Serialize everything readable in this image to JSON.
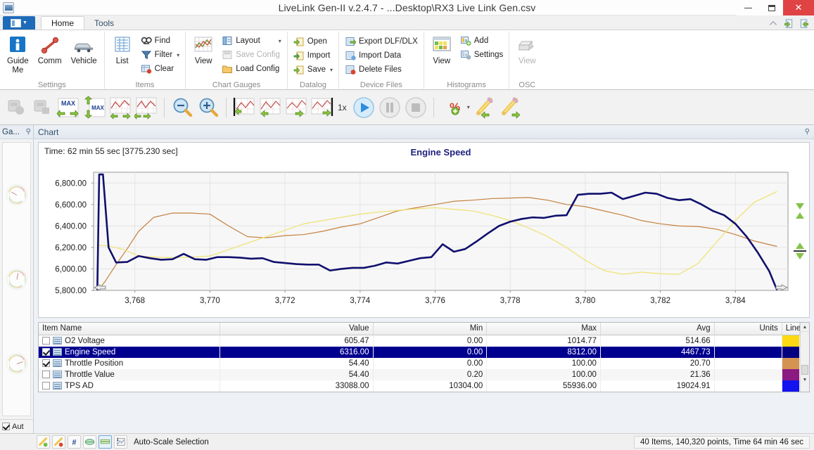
{
  "window": {
    "title": "LiveLink Gen-II  v.2.4.7 - ...Desktop\\RX3 Live Link Gen.csv",
    "minimize": "—",
    "maximize": "□",
    "close": "✕"
  },
  "ribbon": {
    "app_button": "app-menu",
    "tabs": [
      {
        "label": "Home",
        "active": true
      },
      {
        "label": "Tools",
        "active": false
      }
    ],
    "quick_icons": [
      "help-icon",
      "import-icon",
      "export-icon"
    ],
    "groups": [
      {
        "name": "Settings",
        "label": "Settings",
        "big_buttons": [
          {
            "label": "Guide\nMe",
            "line1": "Guide",
            "line2": "Me",
            "icon": "guide-me-icon"
          },
          {
            "label": "Comm",
            "icon": "comm-icon"
          },
          {
            "label": "Vehicle",
            "icon": "vehicle-icon"
          }
        ],
        "small_buttons": []
      },
      {
        "name": "Items",
        "label": "Items",
        "big_buttons": [
          {
            "label": "List",
            "icon": "list-icon"
          }
        ],
        "small_buttons": [
          {
            "label": "Find",
            "icon": "find-icon",
            "disabled": false,
            "caret": false
          },
          {
            "label": "Filter",
            "icon": "filter-icon",
            "disabled": false,
            "caret": true
          },
          {
            "label": "Clear",
            "icon": "clear-icon",
            "disabled": false,
            "caret": false
          }
        ]
      },
      {
        "name": "Chart Gauges",
        "label": "Chart Gauges",
        "big_buttons": [
          {
            "label": "View",
            "icon": "chart-view-icon"
          }
        ],
        "small_buttons": [
          {
            "label": "Layout",
            "icon": "layout-icon",
            "disabled": false,
            "caret": true
          },
          {
            "label": "Save Config",
            "icon": "save-config-icon",
            "disabled": true,
            "caret": false
          },
          {
            "label": "Load Config",
            "icon": "load-config-icon",
            "disabled": false,
            "caret": false
          }
        ]
      },
      {
        "name": "Datalog",
        "label": "Datalog",
        "big_buttons": [],
        "small_buttons": [
          {
            "label": "Open",
            "icon": "open-icon",
            "disabled": false,
            "caret": false
          },
          {
            "label": "Import",
            "icon": "import-icon",
            "disabled": false,
            "caret": false
          },
          {
            "label": "Save",
            "icon": "save-icon",
            "disabled": false,
            "caret": true
          }
        ]
      },
      {
        "name": "Device Files",
        "label": "Device Files",
        "big_buttons": [],
        "small_buttons": [
          {
            "label": "Export DLF/DLX",
            "icon": "export-dlf-icon",
            "disabled": false,
            "caret": false
          },
          {
            "label": "Import Data",
            "icon": "import-data-icon",
            "disabled": false,
            "caret": false
          },
          {
            "label": "Delete Files",
            "icon": "delete-files-icon",
            "disabled": false,
            "caret": false
          }
        ]
      },
      {
        "name": "Histograms",
        "label": "Histograms",
        "big_buttons": [
          {
            "label": "View",
            "icon": "histogram-view-icon"
          }
        ],
        "small_buttons": [
          {
            "label": "Add",
            "icon": "add-icon",
            "disabled": false,
            "caret": false
          },
          {
            "label": "Settings",
            "icon": "settings-icon",
            "disabled": false,
            "caret": false
          }
        ]
      },
      {
        "name": "OSC",
        "label": "OSC",
        "big_buttons": [
          {
            "label": "View",
            "icon": "osc-view-icon",
            "disabled": true
          }
        ],
        "small_buttons": []
      }
    ]
  },
  "toolbar": {
    "speed_label": "1x",
    "buttons": [
      {
        "name": "record-disabled-icon",
        "disabled": true
      },
      {
        "name": "stop-record-disabled-icon",
        "disabled": true
      },
      {
        "name": "max-left-right-icon",
        "disabled": false
      },
      {
        "name": "max-up-down-icon",
        "disabled": false
      },
      {
        "name": "chart-pan-left-right-icon",
        "disabled": false
      },
      {
        "name": "chart-pan-right-left-icon",
        "disabled": false
      },
      {
        "name": "zoom-out-icon",
        "disabled": false
      },
      {
        "name": "zoom-in-icon",
        "disabled": false
      },
      {
        "name": "chart-marker-start-icon",
        "disabled": false
      },
      {
        "name": "chart-marker-left-icon",
        "disabled": false
      },
      {
        "name": "chart-marker-right-icon",
        "disabled": false
      },
      {
        "name": "chart-marker-end-icon",
        "disabled": false
      },
      {
        "name": "play-button",
        "disabled": false
      },
      {
        "name": "pause-button",
        "disabled": true
      },
      {
        "name": "stop-button",
        "disabled": true
      },
      {
        "name": "percent-icon",
        "disabled": false
      },
      {
        "name": "edit-back-icon",
        "disabled": false
      },
      {
        "name": "edit-forward-icon",
        "disabled": false
      }
    ]
  },
  "gauge_panel": {
    "title": "Ga...",
    "pin": "pin-icon",
    "auto_label": "Aut",
    "auto_checked": true,
    "gauges": [
      "gauge-1",
      "gauge-2",
      "gauge-3"
    ]
  },
  "chart_panel": {
    "header_title": "Chart",
    "pin": "pin-icon",
    "time_label": "Time: 62 min 55 sec [3775.230 sec]"
  },
  "chart_data": {
    "type": "line",
    "title": "Engine Speed",
    "xlabel": "",
    "ylabel": "",
    "xlim": [
      3766.9,
      3785.4
    ],
    "ylim": [
      5800,
      6900
    ],
    "yticks": [
      5800,
      6000,
      6200,
      6400,
      6600,
      6800
    ],
    "ytick_labels": [
      "5,800.00",
      "6,000.00",
      "6,200.00",
      "6,400.00",
      "6,600.00",
      "6,800.00"
    ],
    "xticks": [
      3768,
      3770,
      3772,
      3774,
      3776,
      3778,
      3780,
      3782,
      3784
    ],
    "xtick_labels": [
      "3,768",
      "3,770",
      "3,772",
      "3,774",
      "3,776",
      "3,778",
      "3,780",
      "3,782",
      "3,784"
    ],
    "grid": true,
    "legend_position": "none",
    "series": [
      {
        "name": "Engine Speed",
        "color": "#10106e",
        "width": 2.6,
        "x": [
          3767.0,
          3767.05,
          3767.15,
          3767.3,
          3767.5,
          3767.8,
          3768.1,
          3768.4,
          3768.7,
          3769.0,
          3769.3,
          3769.6,
          3769.9,
          3770.2,
          3770.5,
          3770.8,
          3771.1,
          3771.4,
          3771.7,
          3772.0,
          3772.3,
          3772.6,
          3772.9,
          3773.2,
          3773.5,
          3773.8,
          3774.1,
          3774.4,
          3774.7,
          3775.0,
          3775.3,
          3775.6,
          3775.9,
          3776.2,
          3776.5,
          3776.8,
          3777.1,
          3777.4,
          3777.7,
          3778.0,
          3778.3,
          3778.6,
          3778.9,
          3779.2,
          3779.5,
          3779.8,
          3780.1,
          3780.4,
          3780.7,
          3781.0,
          3781.3,
          3781.6,
          3781.9,
          3782.2,
          3782.5,
          3782.8,
          3783.1,
          3783.4,
          3783.7,
          3784.0,
          3784.3,
          3784.6,
          3784.9,
          3785.1
        ],
        "y": [
          5810,
          6880,
          6880,
          6200,
          6060,
          6065,
          6120,
          6100,
          6085,
          6090,
          6140,
          6090,
          6085,
          6110,
          6110,
          6105,
          6095,
          6100,
          6065,
          6055,
          6045,
          6040,
          6040,
          5985,
          6000,
          6010,
          6010,
          6030,
          6060,
          6050,
          6075,
          6100,
          6110,
          6230,
          6160,
          6185,
          6255,
          6330,
          6400,
          6440,
          6465,
          6480,
          6475,
          6495,
          6500,
          6690,
          6700,
          6700,
          6710,
          6650,
          6680,
          6710,
          6700,
          6660,
          6640,
          6650,
          6600,
          6540,
          6500,
          6420,
          6300,
          6150,
          5980,
          5810
        ]
      },
      {
        "name": "Throttle Position",
        "color": "#c4813f",
        "width": 1.2,
        "x": [
          3767.0,
          3767.2,
          3767.5,
          3767.8,
          3768.1,
          3768.5,
          3769.0,
          3769.5,
          3770.0,
          3770.5,
          3771.0,
          3771.5,
          3772.0,
          3772.5,
          3773.0,
          3773.5,
          3774.0,
          3774.5,
          3775.0,
          3775.5,
          3776.0,
          3776.5,
          3777.0,
          3777.5,
          3778.0,
          3778.5,
          3779.0,
          3779.5,
          3780.0,
          3780.5,
          3781.0,
          3781.5,
          3782.0,
          3782.5,
          3783.0,
          3783.5,
          3784.0,
          3784.5,
          3785.1
        ],
        "y": [
          5790,
          5880,
          6040,
          6190,
          6350,
          6480,
          6520,
          6520,
          6510,
          6400,
          6300,
          6290,
          6310,
          6320,
          6350,
          6390,
          6420,
          6480,
          6540,
          6570,
          6600,
          6630,
          6640,
          6655,
          6660,
          6665,
          6640,
          6600,
          6580,
          6540,
          6500,
          6450,
          6420,
          6400,
          6395,
          6370,
          6320,
          6260,
          6210
        ]
      },
      {
        "name": "O2 Voltage",
        "color": "#f0e27a",
        "width": 1.3,
        "x": [
          3767.0,
          3767.3,
          3767.7,
          3768.1,
          3768.5,
          3769.0,
          3769.5,
          3770.0,
          3770.5,
          3771.0,
          3771.5,
          3772.0,
          3772.5,
          3773.0,
          3773.5,
          3774.0,
          3774.5,
          3775.0,
          3775.5,
          3776.0,
          3776.5,
          3777.0,
          3777.5,
          3778.0,
          3778.5,
          3779.0,
          3779.5,
          3780.0,
          3780.5,
          3781.0,
          3781.5,
          3782.0,
          3782.5,
          3783.0,
          3783.5,
          3784.0,
          3784.5,
          3785.1
        ],
        "y": [
          6220,
          6215,
          6180,
          6120,
          6110,
          6105,
          6110,
          6120,
          6180,
          6240,
          6300,
          6360,
          6420,
          6450,
          6480,
          6510,
          6530,
          6545,
          6560,
          6570,
          6555,
          6540,
          6500,
          6450,
          6380,
          6300,
          6200,
          6080,
          5985,
          5950,
          5970,
          5955,
          5950,
          6050,
          6250,
          6450,
          6620,
          6720
        ]
      }
    ]
  },
  "table": {
    "columns": [
      {
        "key": "name",
        "label": "Item Name",
        "align": "l"
      },
      {
        "key": "value",
        "label": "Value",
        "align": "r"
      },
      {
        "key": "min",
        "label": "Min",
        "align": "r"
      },
      {
        "key": "max",
        "label": "Max",
        "align": "r"
      },
      {
        "key": "avg",
        "label": "Avg",
        "align": "r"
      },
      {
        "key": "units",
        "label": "Units",
        "align": "r"
      },
      {
        "key": "line",
        "label": "Line",
        "align": "r"
      }
    ],
    "rows": [
      {
        "checked": false,
        "name": "O2 Voltage",
        "value": "605.47",
        "min": "0.00",
        "max": "1014.77",
        "avg": "514.66",
        "units": "",
        "color": "#fcd913",
        "selected": false
      },
      {
        "checked": true,
        "name": "Engine Speed",
        "value": "6316.00",
        "min": "0.00",
        "max": "8312.00",
        "avg": "4467.73",
        "units": "",
        "color": "#000080",
        "selected": true
      },
      {
        "checked": true,
        "name": "Throttle Position",
        "value": "54.40",
        "min": "0.00",
        "max": "100.00",
        "avg": "20.70",
        "units": "",
        "color": "#d59352",
        "selected": false
      },
      {
        "checked": false,
        "name": "Throttle Value",
        "value": "54.40",
        "min": "0.20",
        "max": "100.00",
        "avg": "21.36",
        "units": "",
        "color": "#8b1a82",
        "selected": false
      },
      {
        "checked": false,
        "name": "TPS AD",
        "value": "33088.00",
        "min": "10304.00",
        "max": "55936.00",
        "avg": "19024.91",
        "units": "",
        "color": "#1313f0",
        "selected": false
      }
    ]
  },
  "statusbar": {
    "buttons": [
      {
        "name": "add-marker-green-icon",
        "active": false
      },
      {
        "name": "add-marker-red-icon",
        "active": false
      },
      {
        "name": "hash-icon",
        "active": false
      },
      {
        "name": "range-icon",
        "active": false
      },
      {
        "name": "scale-icon",
        "active": true
      },
      {
        "name": "auto-scale-icon",
        "active": false
      }
    ],
    "label": "Auto-Scale Selection",
    "info": "40 Items, 140,320 points, Time 64 min 46 sec"
  }
}
